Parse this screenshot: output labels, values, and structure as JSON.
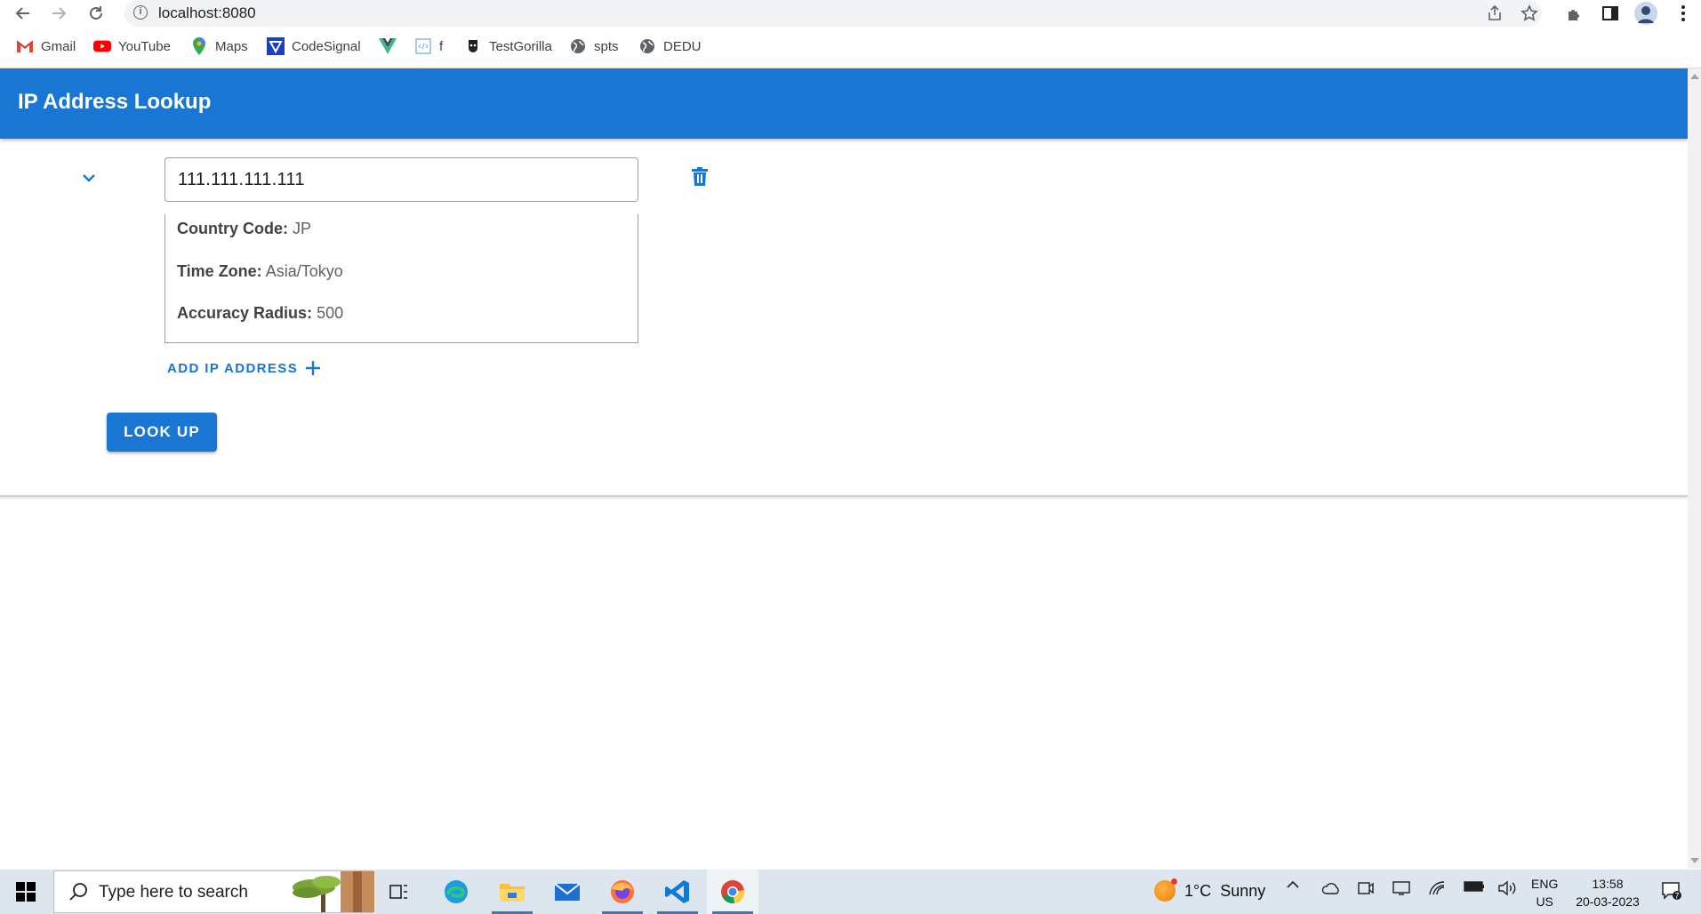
{
  "browser": {
    "url": "localhost:8080",
    "bookmarks": [
      {
        "label": "Gmail",
        "icon": "gmail-icon"
      },
      {
        "label": "YouTube",
        "icon": "youtube-icon"
      },
      {
        "label": "Maps",
        "icon": "maps-icon"
      },
      {
        "label": "CodeSignal",
        "icon": "codesignal-icon"
      },
      {
        "label": "",
        "icon": "vue-icon"
      },
      {
        "label": "f",
        "icon": "code-page-icon"
      },
      {
        "label": "TestGorilla",
        "icon": "testgorilla-icon"
      },
      {
        "label": "spts",
        "icon": "globe-icon"
      },
      {
        "label": "DEDU",
        "icon": "globe-icon"
      }
    ]
  },
  "app": {
    "title": "IP Address Lookup",
    "primary_color": "#1976d2",
    "entry": {
      "ip_value": "111.111.111.111",
      "details": [
        {
          "label": "Country Code:",
          "value": "JP"
        },
        {
          "label": "Time Zone:",
          "value": "Asia/Tokyo"
        },
        {
          "label": "Accuracy Radius:",
          "value": "500"
        }
      ]
    },
    "add_ip_label": "ADD IP ADDRESS",
    "lookup_label": "LOOK UP"
  },
  "taskbar": {
    "search_placeholder": "Type here to search",
    "weather_temp": "1°C",
    "weather_text": "Sunny",
    "lang_line1": "ENG",
    "lang_line2": "US",
    "time": "13:58",
    "date": "20-03-2023",
    "notification_count": "7"
  }
}
